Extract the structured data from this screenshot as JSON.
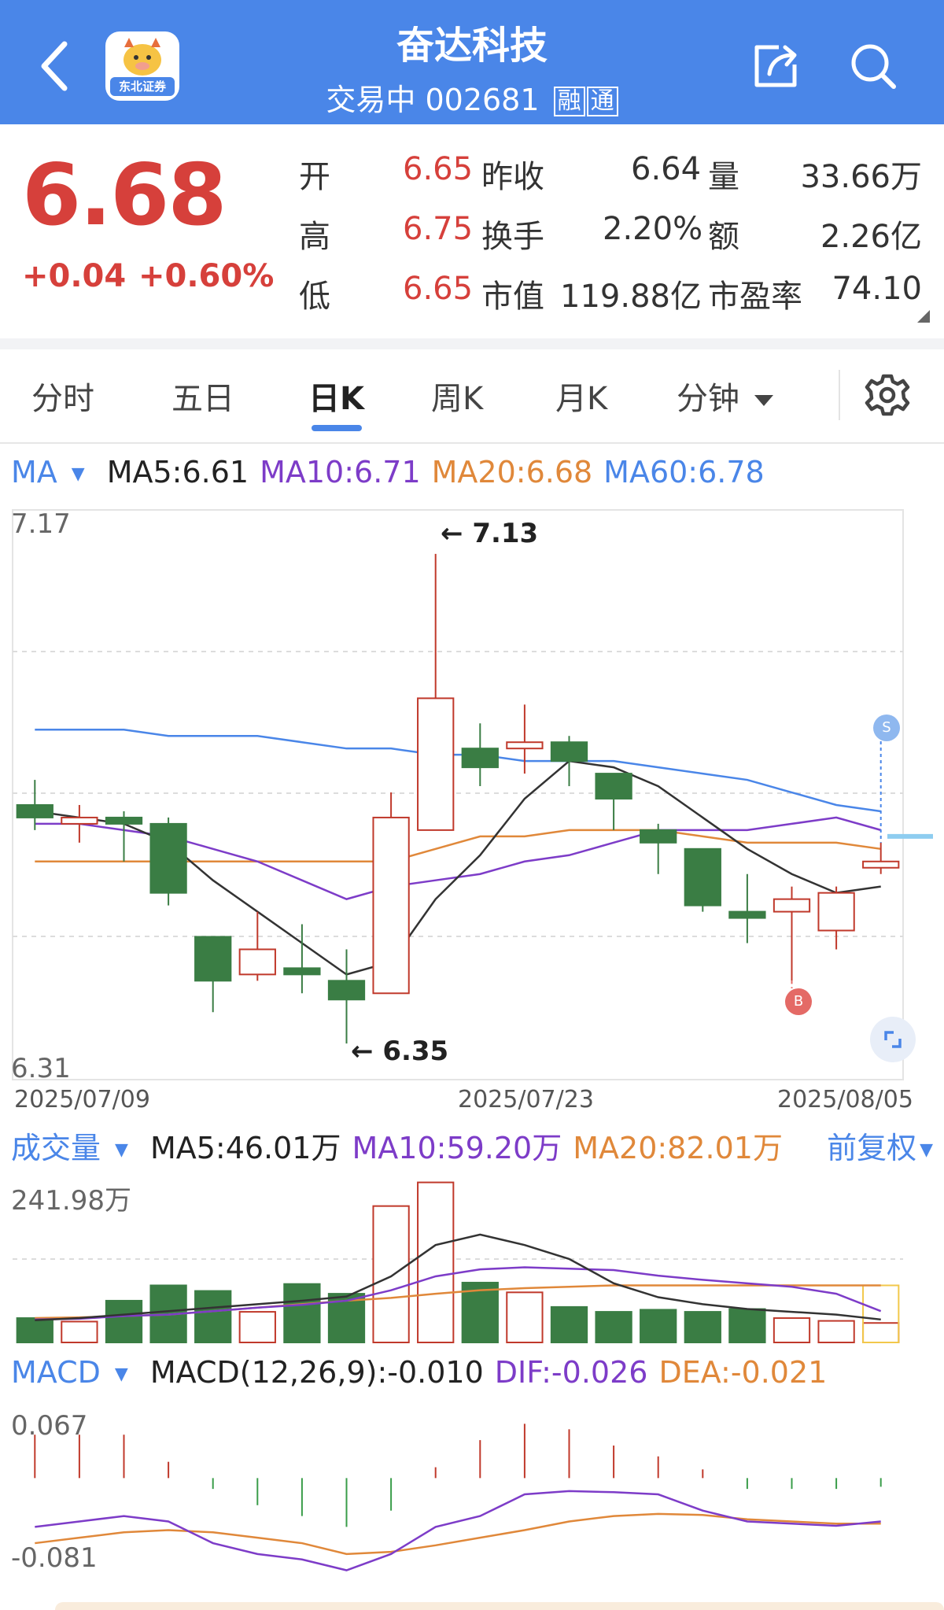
{
  "header": {
    "title": "奋达科技",
    "status": "交易中",
    "code": "002681",
    "tag1": "融",
    "tag2": "通",
    "logo_text": "东北证券",
    "icons": [
      "back-arrow-icon",
      "share-icon",
      "search-icon"
    ]
  },
  "quote": {
    "price": "6.68",
    "change": "+0.04",
    "change_pct": "+0.60%",
    "open_label": "开",
    "open": "6.65",
    "prev_close_label": "昨收",
    "prev_close": "6.64",
    "volume_label": "量",
    "volume": "33.66万",
    "high_label": "高",
    "high": "6.75",
    "turnover_label": "换手",
    "turnover": "2.20%",
    "amount_label": "额",
    "amount": "2.26亿",
    "low_label": "低",
    "low": "6.65",
    "mktcap_label": "市值",
    "mktcap": "119.88亿",
    "pe_label": "市盈率",
    "pe": "74.10"
  },
  "tabs": {
    "t1": "分时",
    "t2": "五日",
    "t3": "日K",
    "t4": "周K",
    "t5": "月K",
    "t6": "分钟",
    "active": "日K"
  },
  "ma_legend": {
    "name": "MA",
    "ma5": "MA5:6.61",
    "ma10": "MA10:6.71",
    "ma20": "MA20:6.68",
    "ma60": "MA60:6.78"
  },
  "kline_axis": {
    "top": "7.17",
    "bottom": "6.31",
    "date1": "2025/07/09",
    "date2": "2025/07/23",
    "date3": "2025/08/05",
    "high_annot": "← 7.13",
    "low_annot": "← 6.35",
    "s_marker": "S",
    "b_marker": "B"
  },
  "vol_legend": {
    "name": "成交量",
    "ma5": "MA5:46.01万",
    "ma10": "MA10:59.20万",
    "ma20": "MA20:82.01万",
    "adjust": "前复权",
    "top": "241.98万"
  },
  "macd_legend": {
    "name": "MACD",
    "params": "MACD(12,26,9):-0.010",
    "dif": "DIF:-0.026",
    "dea": "DEA:-0.021",
    "top": "0.067",
    "bottom": "-0.081"
  },
  "colors": {
    "up": "#c0392b",
    "down": "#3a7d44",
    "ma5": "#333333",
    "ma10": "#7d3cc8",
    "ma20": "#e0883a",
    "ma60": "#4a86e8",
    "accent": "#4a86e8"
  },
  "chart_data": {
    "type": "candlestick",
    "price_range": [
      6.31,
      7.17
    ],
    "candles": [
      {
        "o": 6.73,
        "h": 6.77,
        "l": 6.69,
        "c": 6.71
      },
      {
        "o": 6.7,
        "h": 6.73,
        "l": 6.67,
        "c": 6.71
      },
      {
        "o": 6.71,
        "h": 6.72,
        "l": 6.64,
        "c": 6.7
      },
      {
        "o": 6.7,
        "h": 6.71,
        "l": 6.57,
        "c": 6.59
      },
      {
        "o": 6.52,
        "h": 6.52,
        "l": 6.4,
        "c": 6.45
      },
      {
        "o": 6.46,
        "h": 6.56,
        "l": 6.45,
        "c": 6.5
      },
      {
        "o": 6.47,
        "h": 6.54,
        "l": 6.43,
        "c": 6.46
      },
      {
        "o": 6.45,
        "h": 6.5,
        "l": 6.35,
        "c": 6.42
      },
      {
        "o": 6.43,
        "h": 6.75,
        "l": 6.43,
        "c": 6.71
      },
      {
        "o": 6.69,
        "h": 7.13,
        "l": 6.69,
        "c": 6.9
      },
      {
        "o": 6.82,
        "h": 6.86,
        "l": 6.76,
        "c": 6.79
      },
      {
        "o": 6.82,
        "h": 6.89,
        "l": 6.78,
        "c": 6.83
      },
      {
        "o": 6.83,
        "h": 6.84,
        "l": 6.76,
        "c": 6.8
      },
      {
        "o": 6.78,
        "h": 6.78,
        "l": 6.69,
        "c": 6.74
      },
      {
        "o": 6.69,
        "h": 6.7,
        "l": 6.62,
        "c": 6.67
      },
      {
        "o": 6.66,
        "h": 6.66,
        "l": 6.56,
        "c": 6.57
      },
      {
        "o": 6.56,
        "h": 6.62,
        "l": 6.51,
        "c": 6.55
      },
      {
        "o": 6.56,
        "h": 6.6,
        "l": 6.45,
        "c": 6.58
      },
      {
        "o": 6.53,
        "h": 6.6,
        "l": 6.5,
        "c": 6.59
      },
      {
        "o": 6.63,
        "h": 6.67,
        "l": 6.62,
        "c": 6.64
      }
    ],
    "ma5": [
      6.72,
      6.71,
      6.7,
      6.67,
      6.61,
      6.56,
      6.51,
      6.46,
      6.48,
      6.58,
      6.65,
      6.74,
      6.8,
      6.79,
      6.76,
      6.71,
      6.66,
      6.62,
      6.59,
      6.6
    ],
    "ma10": [
      6.7,
      6.7,
      6.69,
      6.68,
      6.66,
      6.64,
      6.61,
      6.58,
      6.6,
      6.61,
      6.62,
      6.64,
      6.65,
      6.67,
      6.69,
      6.69,
      6.69,
      6.7,
      6.71,
      6.69
    ],
    "ma20": [
      6.64,
      6.64,
      6.64,
      6.64,
      6.64,
      6.64,
      6.64,
      6.64,
      6.64,
      6.66,
      6.68,
      6.68,
      6.69,
      6.69,
      6.69,
      6.68,
      6.67,
      6.67,
      6.67,
      6.66
    ],
    "ma60": [
      6.85,
      6.85,
      6.85,
      6.84,
      6.84,
      6.84,
      6.83,
      6.82,
      6.82,
      6.81,
      6.81,
      6.8,
      6.8,
      6.8,
      6.79,
      6.78,
      6.77,
      6.75,
      6.73,
      6.72
    ],
    "volume_max": 241.98,
    "volume": [
      35,
      30,
      60,
      82,
      74,
      44,
      84,
      70,
      196,
      230,
      86,
      72,
      51,
      44,
      47,
      44,
      48,
      35,
      31,
      28
    ],
    "vol_ma5": [
      32,
      35,
      40,
      45,
      50,
      55,
      60,
      66,
      95,
      140,
      155,
      140,
      120,
      85,
      65,
      55,
      48,
      44,
      40,
      33
    ],
    "vol_ma10": [
      33,
      34,
      38,
      40,
      45,
      50,
      54,
      60,
      75,
      95,
      105,
      108,
      106,
      104,
      96,
      90,
      85,
      80,
      70,
      45
    ],
    "vol_ma20": [
      35,
      36,
      38,
      40,
      45,
      50,
      55,
      60,
      64,
      70,
      75,
      78,
      80,
      82,
      82,
      82,
      82,
      82,
      82,
      82
    ],
    "macd_range": [
      -0.081,
      0.067
    ],
    "macd_hist": [
      0.04,
      0.04,
      0.04,
      0.015,
      -0.01,
      -0.025,
      -0.035,
      -0.045,
      -0.03,
      0.01,
      0.035,
      0.05,
      0.045,
      0.03,
      0.02,
      0.008,
      -0.01,
      -0.01,
      -0.01,
      -0.008
    ],
    "dif": [
      -0.045,
      -0.04,
      -0.035,
      -0.04,
      -0.06,
      -0.07,
      -0.075,
      -0.085,
      -0.07,
      -0.045,
      -0.035,
      -0.015,
      -0.012,
      -0.013,
      -0.015,
      -0.03,
      -0.04,
      -0.042,
      -0.044,
      -0.04
    ],
    "dea": [
      -0.06,
      -0.055,
      -0.05,
      -0.048,
      -0.05,
      -0.055,
      -0.06,
      -0.07,
      -0.068,
      -0.062,
      -0.055,
      -0.048,
      -0.04,
      -0.035,
      -0.033,
      -0.034,
      -0.038,
      -0.04,
      -0.042,
      -0.042
    ]
  }
}
